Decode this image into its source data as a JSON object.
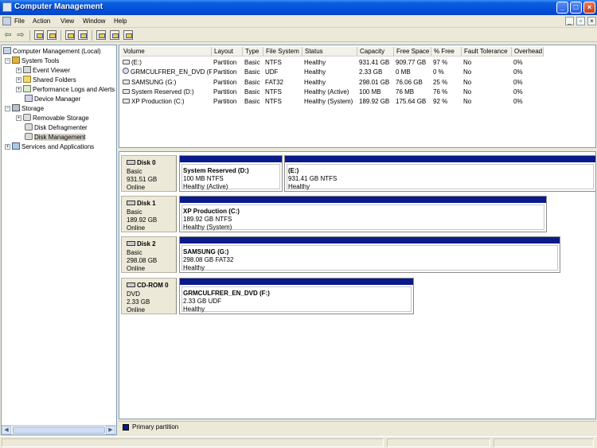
{
  "window": {
    "title": "Computer Management",
    "controls": {
      "minimize": "_",
      "maximize": "□",
      "close": "×"
    }
  },
  "menubar": {
    "items": [
      "File",
      "Action",
      "View",
      "Window",
      "Help"
    ],
    "mdi": {
      "minimize": "_",
      "restore": "▫",
      "close": "×"
    }
  },
  "toolbar": {
    "buttons": [
      "back-icon",
      "forward-icon",
      "up-folder-icon",
      "show-hide-tree-icon",
      "properties-icon",
      "help-icon",
      "refresh-icon",
      "export-icon",
      "settings-icon"
    ],
    "arrows": {
      "back": "⇦",
      "forward": "⇨"
    }
  },
  "tree": {
    "root": "Computer Management (Local)",
    "system_tools": "System Tools",
    "event_viewer": "Event Viewer",
    "shared_folders": "Shared Folders",
    "performance_logs": "Performance Logs and Alerts",
    "device_manager": "Device Manager",
    "storage": "Storage",
    "removable_storage": "Removable Storage",
    "disk_defragmenter": "Disk Defragmenter",
    "disk_management": "Disk Management",
    "services": "Services and Applications",
    "expander_minus": "−",
    "expander_plus": "+",
    "scroll_left": "◀",
    "scroll_right": "▶"
  },
  "volume_list": {
    "columns": [
      "Volume",
      "Layout",
      "Type",
      "File System",
      "Status",
      "Capacity",
      "Free Space",
      "% Free",
      "Fault Tolerance",
      "Overhead"
    ],
    "rows": [
      [
        "(E:)",
        "Partition",
        "Basic",
        "NTFS",
        "Healthy",
        "931.41 GB",
        "909.77 GB",
        "97 %",
        "No",
        "0%"
      ],
      [
        "GRMCULFRER_EN_DVD (F:)",
        "Partition",
        "Basic",
        "UDF",
        "Healthy",
        "2.33 GB",
        "0 MB",
        "0 %",
        "No",
        "0%"
      ],
      [
        "SAMSUNG (G:)",
        "Partition",
        "Basic",
        "FAT32",
        "Healthy",
        "298.01 GB",
        "76.06 GB",
        "25 %",
        "No",
        "0%"
      ],
      [
        "System Reserved (D:)",
        "Partition",
        "Basic",
        "NTFS",
        "Healthy (Active)",
        "100 MB",
        "76 MB",
        "76 %",
        "No",
        "0%"
      ],
      [
        "XP Production (C:)",
        "Partition",
        "Basic",
        "NTFS",
        "Healthy (System)",
        "189.92 GB",
        "175.64 GB",
        "92 %",
        "No",
        "0%"
      ]
    ]
  },
  "disks": [
    {
      "name": "Disk 0",
      "type": "Basic",
      "size": "931.51 GB",
      "status": "Online",
      "partitions": [
        {
          "name": "System Reserved  (D:)",
          "size_fs": "100 MB NTFS",
          "status": "Healthy (Active)"
        },
        {
          "name": "(E:)",
          "size_fs": "931.41 GB NTFS",
          "status": "Healthy"
        }
      ]
    },
    {
      "name": "Disk 1",
      "type": "Basic",
      "size": "189.92 GB",
      "status": "Online",
      "partitions": [
        {
          "name": "XP Production  (C:)",
          "size_fs": "189.92 GB NTFS",
          "status": "Healthy (System)"
        }
      ]
    },
    {
      "name": "Disk 2",
      "type": "Basic",
      "size": "298.08 GB",
      "status": "Online",
      "partitions": [
        {
          "name": "SAMSUNG  (G:)",
          "size_fs": "298.08 GB FAT32",
          "status": "Healthy"
        }
      ]
    },
    {
      "name": "CD-ROM 0",
      "type": "DVD",
      "size": "2.33 GB",
      "status": "Online",
      "partitions": [
        {
          "name": "GRMCULFRER_EN_DVD  (F:)",
          "size_fs": "2.33 GB UDF",
          "status": "Healthy"
        }
      ]
    }
  ],
  "legend": {
    "label": "Primary partition",
    "color": "#0a1a8a"
  }
}
